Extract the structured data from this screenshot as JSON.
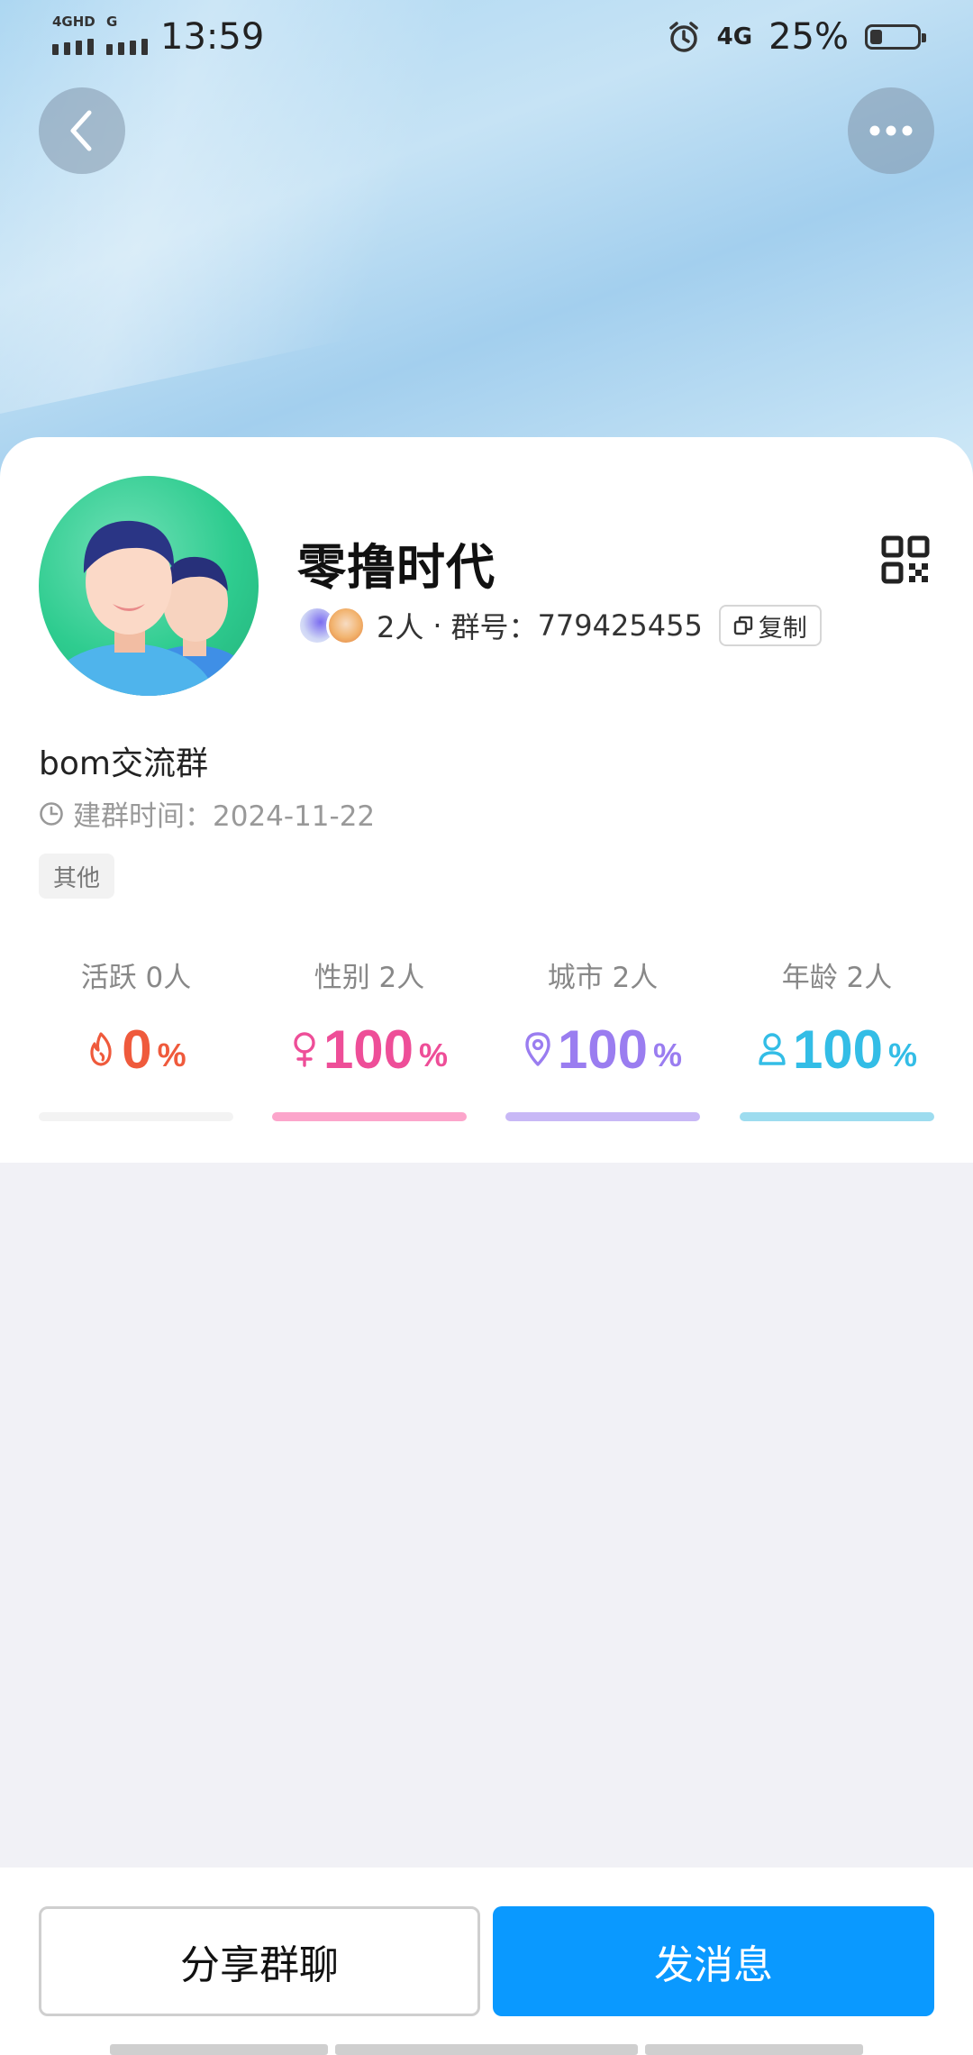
{
  "status_bar": {
    "network_left": "4GHD",
    "network_left2": "G",
    "time": "13:59",
    "network_right": "4G",
    "battery": "25%",
    "battery_level": 0.25
  },
  "header": {
    "back_icon": "chevron-left-icon",
    "more_icon": "more-dots-icon"
  },
  "group": {
    "name": "零撸时代",
    "member_count": "2人",
    "separator": "·",
    "id_label": "群号：",
    "id_value": "779425455",
    "copy_label": "复制",
    "description": "bom交流群",
    "created_label": "建群时间：",
    "created_date": "2024-11-22",
    "tag": "其他"
  },
  "stats": [
    {
      "label": "活跃 0人",
      "value": "0",
      "unit": "%",
      "icon": "flame-icon",
      "color": "#ef5a3c",
      "bar_color": "#f3f3f3",
      "level": 0
    },
    {
      "label": "性别 2人",
      "value": "100",
      "unit": "%",
      "icon": "female-icon",
      "color": "#ee4e98",
      "bar_color": "#fca5cb",
      "level": 1
    },
    {
      "label": "城市 2人",
      "value": "100",
      "unit": "%",
      "icon": "location-pin-icon",
      "color": "#9a7df0",
      "bar_color": "#c8b8f6",
      "level": 1
    },
    {
      "label": "年龄 2人",
      "value": "100",
      "unit": "%",
      "icon": "person-icon",
      "color": "#33bde6",
      "bar_color": "#9ddcef",
      "level": 1
    }
  ],
  "actions": {
    "share_label": "分享群聊",
    "send_label": "发消息"
  },
  "colors": {
    "primary": "#0a99ff",
    "page_bg": "#f1f1f6"
  }
}
